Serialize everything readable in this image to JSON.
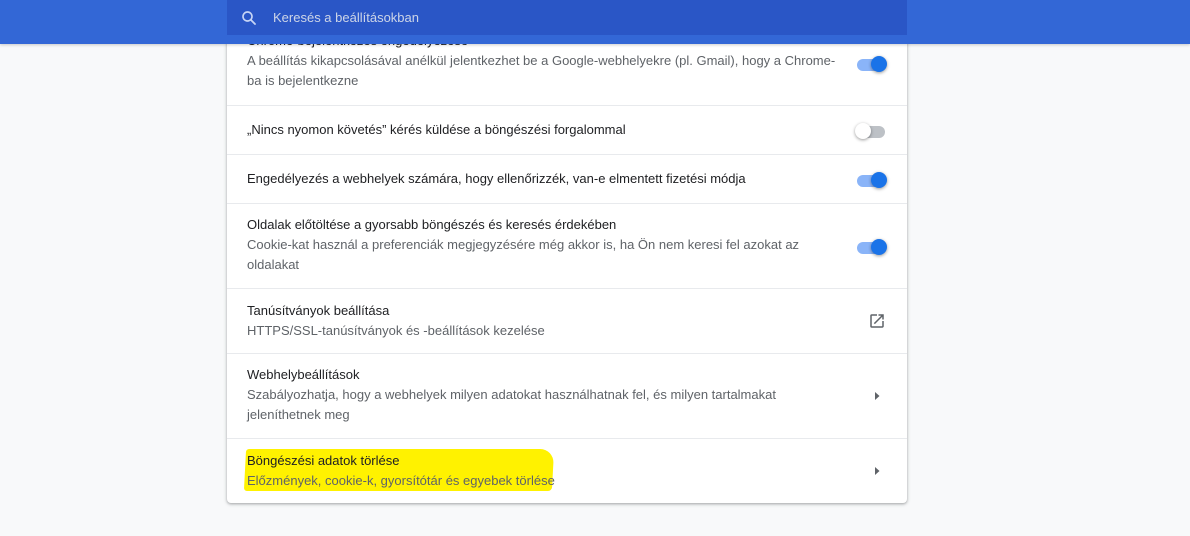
{
  "search": {
    "placeholder": "Keresés a beállításokban"
  },
  "rows": [
    {
      "title": "Chrome-bejelentkezés engedélyezése",
      "desc": "A beállítás kikapcsolásával anélkül jelentkezhet be a Google-webhelyekre (pl. Gmail), hogy a Chrome-ba is bejelentkezne",
      "control": "toggle",
      "enabled": true
    },
    {
      "title": "„Nincs nyomon követés” kérés küldése a böngészési forgalommal",
      "control": "toggle",
      "enabled": false
    },
    {
      "title": "Engedélyezés a webhelyek számára, hogy ellenőrizzék, van-e elmentett fizetési módja",
      "control": "toggle",
      "enabled": true
    },
    {
      "title": "Oldalak előtöltése a gyorsabb böngészés és keresés érdekében",
      "desc": "Cookie-kat használ a preferenciák megjegyzésére még akkor is, ha Ön nem keresi fel azokat az oldalakat",
      "control": "toggle",
      "enabled": true
    },
    {
      "title": "Tanúsítványok beállítása",
      "desc": "HTTPS/SSL-tanúsítványok és -beállítások kezelése",
      "control": "external-link-icon"
    },
    {
      "title": "Webhelybeállítások",
      "desc": "Szabályozhatja, hogy a webhelyek milyen adatokat használhatnak fel, és milyen tartalmakat jeleníthetnek meg",
      "control": "arrow-right-icon"
    },
    {
      "title": "Böngészési adatok törlése",
      "desc": "Előzmények, cookie-k, gyorsítótár és egyebek törlése",
      "control": "arrow-right-icon",
      "highlight_color": "#fff200"
    }
  ],
  "colors": {
    "header": "#3367d6",
    "search_bg": "#2a56c6",
    "toggle_on": "#1a73e8",
    "highlight": "#fff200"
  }
}
